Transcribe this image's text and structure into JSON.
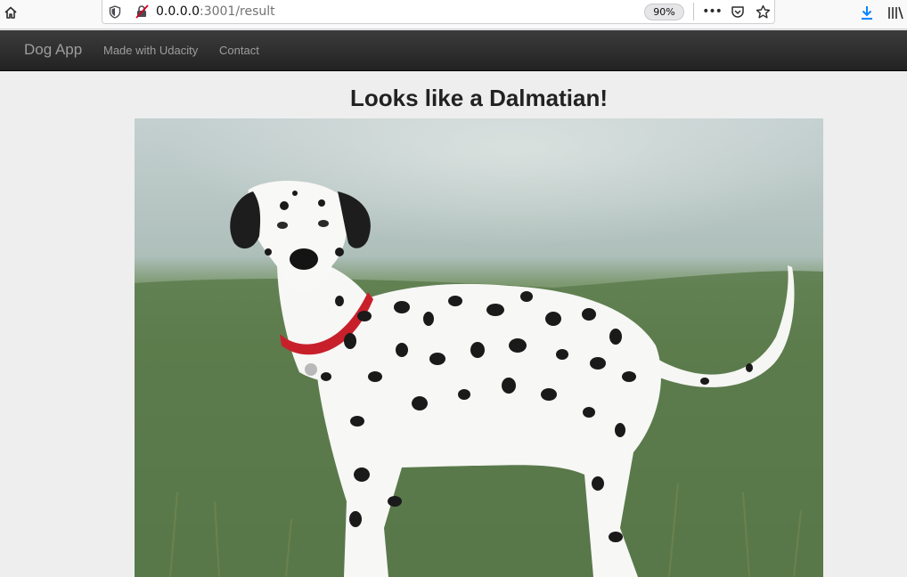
{
  "browser": {
    "url_host": "0.0.0.0",
    "url_rest": ":3001/result",
    "zoom": "90%"
  },
  "navbar": {
    "brand": "Dog App",
    "links": [
      "Made with Udacity",
      "Contact"
    ]
  },
  "result": {
    "title": "Looks like a Dalmatian!",
    "image_subject": "dalmatian-dog"
  },
  "icons": {
    "home": "home-icon",
    "shield": "tracking-protection-shield-icon",
    "insecure": "insecure-connection-icon",
    "more": "page-actions-menu-icon",
    "pocket": "pocket-icon",
    "bookmark": "bookmark-star-icon",
    "download": "download-arrow-icon",
    "library": "library-icon"
  },
  "colors": {
    "navbar_bg": "#222222",
    "navbar_text": "#9d9d9d",
    "page_bg": "#eeeeee",
    "download_accent": "#0a84ff",
    "insecure_accent": "#d70022",
    "collar": "#c8202b"
  }
}
